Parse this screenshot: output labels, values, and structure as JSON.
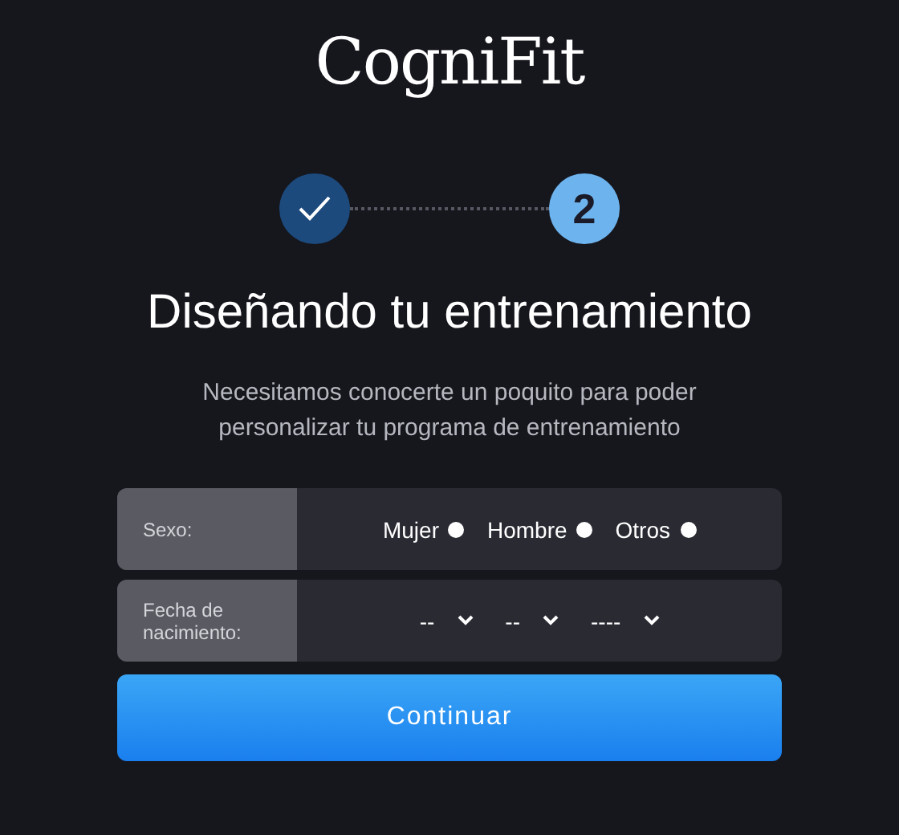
{
  "logo": {
    "text": "CogniFit"
  },
  "steps": [
    {
      "done": true,
      "selected": false
    },
    {
      "label": "2",
      "done": false,
      "selected": true
    }
  ],
  "title": "Diseñando tu entrenamiento",
  "subtitle": "Necesitamos conocerte un poquito para poder personalizar tu programa de entrenamiento",
  "form": {
    "sex": {
      "label": "Sexo:",
      "options": [
        {
          "label": "Mujer",
          "checked": false
        },
        {
          "label": "Hombre",
          "checked": false
        },
        {
          "label": "Otros",
          "checked": false
        }
      ]
    },
    "birthdate": {
      "label": "Fecha de nacimiento:",
      "selects": [
        {
          "value": "--"
        },
        {
          "value": "--"
        },
        {
          "value": "----"
        }
      ]
    }
  },
  "submit": "Continuar"
}
